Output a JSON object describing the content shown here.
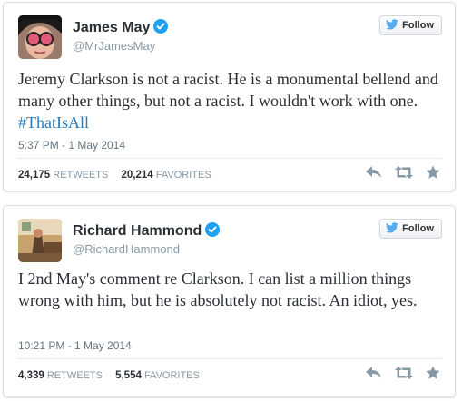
{
  "tweets": [
    {
      "name": "James May",
      "handle": "@MrJamesMay",
      "follow_label": "Follow",
      "text": "Jeremy Clarkson is not a racist. He is a monumental bellend and many other things, but not a racist. I wouldn't work with one.",
      "hashtag": "#ThatIsAll",
      "timestamp": "5:37 PM - 1 May 2014",
      "retweets": "24,175",
      "retweets_label": "RETWEETS",
      "favorites": "20,214",
      "favorites_label": "FAVORITES"
    },
    {
      "name": "Richard Hammond",
      "handle": "@RichardHammond",
      "follow_label": "Follow",
      "text": "I 2nd May's comment re Clarkson. I can list a million things wrong with him, but he is absolutely not racist. An idiot, yes.",
      "timestamp": "10:21 PM - 1 May 2014",
      "retweets": "4,339",
      "retweets_label": "RETWEETS",
      "favorites": "5,554",
      "favorites_label": "FAVORITES"
    }
  ],
  "colors": {
    "verified": "#1da1f2",
    "twitter_bird": "#55acee",
    "hashtag": "#2b7bb9",
    "action_icon": "#8899a6"
  },
  "icons": [
    "verified-badge-icon",
    "twitter-bird-icon",
    "reply-icon",
    "retweet-icon",
    "favorite-icon"
  ]
}
